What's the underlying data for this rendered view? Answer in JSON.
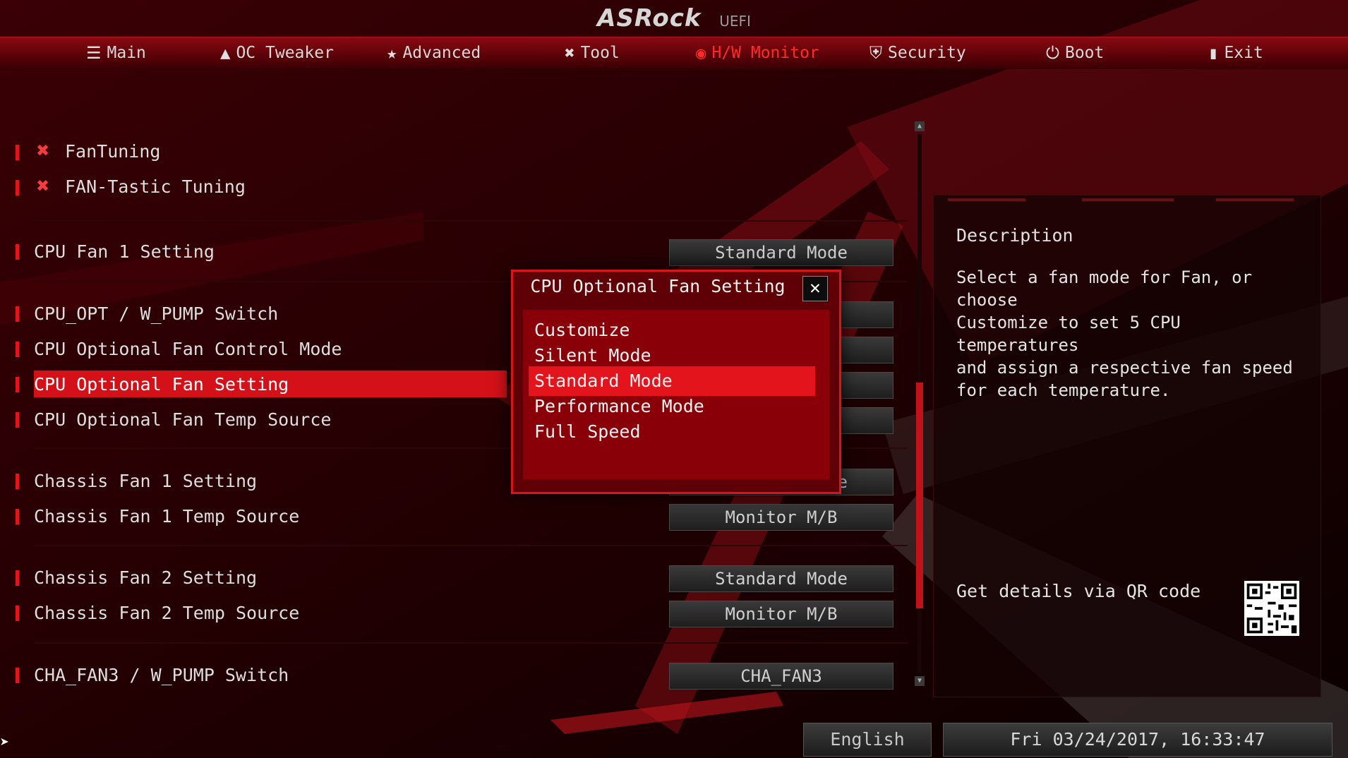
{
  "header": {
    "brand": "ASRock",
    "subtitle": "UEFI"
  },
  "nav": {
    "tabs": [
      {
        "label": "Main",
        "icon": "list-icon"
      },
      {
        "label": "OC Tweaker",
        "icon": "rocket-icon"
      },
      {
        "label": "Advanced",
        "icon": "star-icon"
      },
      {
        "label": "Tool",
        "icon": "tools-icon"
      },
      {
        "label": "H/W Monitor",
        "icon": "monitor-icon",
        "active": true
      },
      {
        "label": "Security",
        "icon": "shield-icon"
      },
      {
        "label": "Boot",
        "icon": "power-icon"
      },
      {
        "label": "Exit",
        "icon": "exit-door-icon"
      }
    ]
  },
  "settings": {
    "tools": [
      {
        "label": "FanTuning",
        "icon": "tools-icon"
      },
      {
        "label": "FAN-Tastic Tuning",
        "icon": "tools-icon"
      }
    ],
    "rows": [
      {
        "label": "CPU Fan 1 Setting",
        "value": "Standard Mode"
      },
      {
        "label": "CPU_OPT / W_PUMP Switch",
        "value": ""
      },
      {
        "label": "CPU Optional Fan Control Mode",
        "value": ""
      },
      {
        "label": "CPU Optional Fan Setting",
        "value": ""
      },
      {
        "label": "CPU Optional Fan Temp Source",
        "value": ""
      },
      {
        "label": "Chassis Fan 1 Setting",
        "value": "Standard Mode"
      },
      {
        "label": "Chassis Fan 1 Temp Source",
        "value": "Monitor M/B"
      },
      {
        "label": "Chassis Fan 2 Setting",
        "value": "Standard Mode"
      },
      {
        "label": "Chassis Fan 2 Temp Source",
        "value": "Monitor M/B"
      },
      {
        "label": "CHA_FAN3 / W_PUMP Switch",
        "value": "CHA_FAN3"
      }
    ],
    "selected_index": 3
  },
  "popup": {
    "title": "CPU Optional Fan Setting",
    "close_icon": "close-icon",
    "options": [
      "Customize",
      "Silent Mode",
      "Standard Mode",
      "Performance Mode",
      "Full Speed"
    ],
    "selected": "Standard Mode"
  },
  "description": {
    "header": "Description",
    "text": "Select a fan mode for Fan, or choose\nCustomize to set 5 CPU temperatures\nand assign a respective fan speed\nfor each temperature.",
    "qr_label": "Get details via QR code"
  },
  "footer": {
    "language": "English",
    "datetime": "Fri 03/24/2017, 16:33:47"
  },
  "colors": {
    "accent": "#d41119",
    "nav_bg": "#5a0208",
    "popup_bg": "#5e0006",
    "background": "#050000"
  }
}
